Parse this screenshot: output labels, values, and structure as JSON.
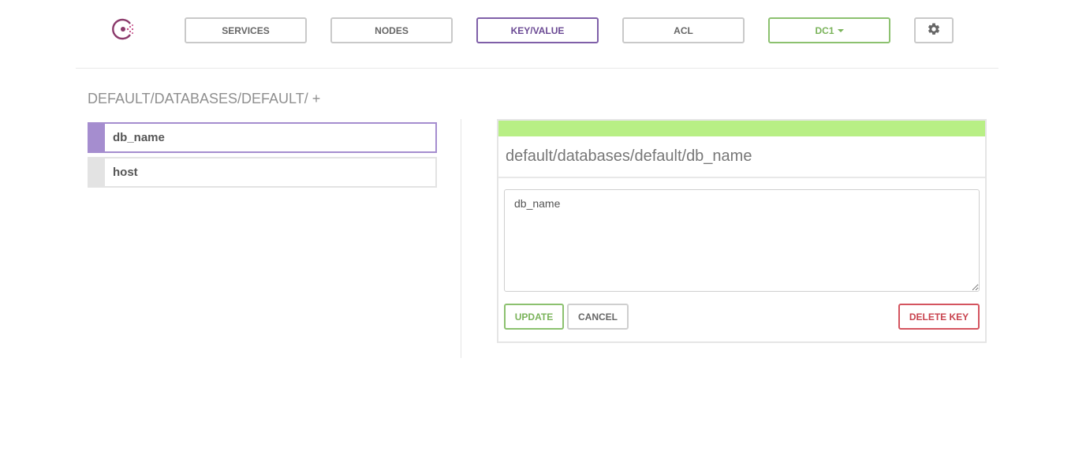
{
  "nav": {
    "logo_icon": "consul-logo-icon",
    "items": [
      {
        "label": "SERVICES"
      },
      {
        "label": "NODES"
      },
      {
        "label": "KEY/VALUE"
      },
      {
        "label": "ACL"
      }
    ],
    "active": "KEY/VALUE",
    "datacenter": {
      "label": "DC1"
    },
    "settings_icon": "gear-icon"
  },
  "breadcrumb": {
    "path": "DEFAULT/DATABASES/DEFAULT/",
    "add_label": "+"
  },
  "keys": [
    {
      "label": "db_name",
      "selected": true
    },
    {
      "label": "host",
      "selected": false
    }
  ],
  "editor": {
    "title": "default/databases/default/db_name",
    "value": "db_name",
    "update_label": "UPDATE",
    "cancel_label": "CANCEL",
    "delete_label": "DELETE KEY"
  },
  "colors": {
    "accent_purple": "#7f5fa8",
    "selected_purple": "#a58dcf",
    "success_green": "#8cc16f",
    "status_bar_green": "#b8ef85",
    "danger_red": "#c8434e"
  }
}
